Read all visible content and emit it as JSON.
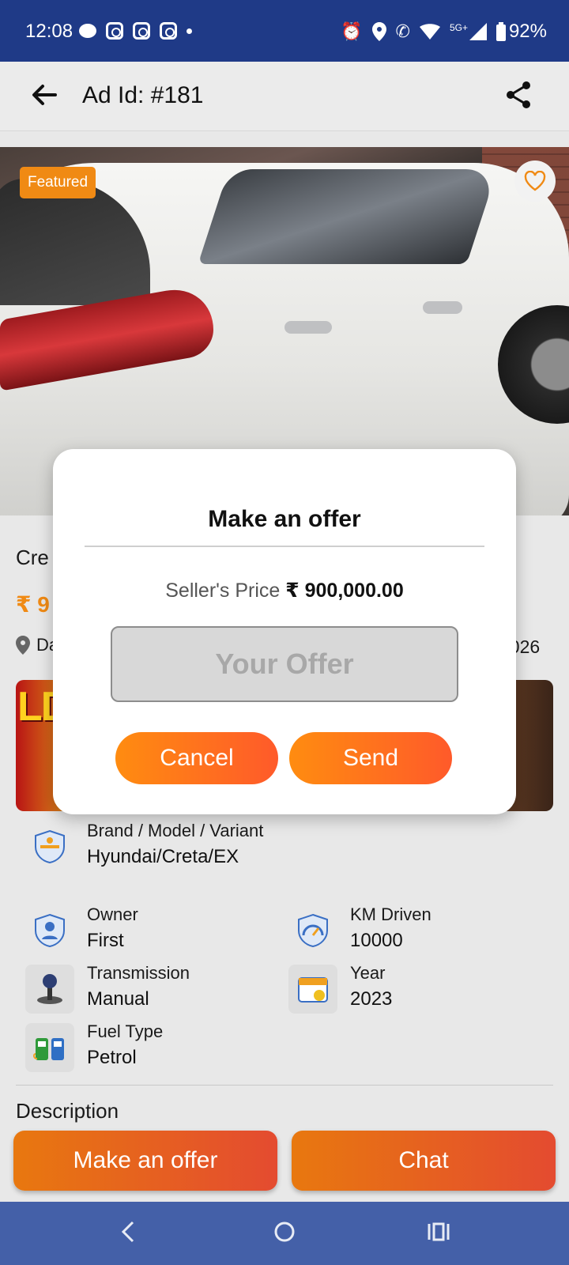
{
  "status_bar": {
    "time": "12:08",
    "network": "5G+",
    "battery": "92%",
    "left_icons": [
      "message-icon",
      "instagram-icon",
      "instagram-icon",
      "instagram-icon",
      "dot-icon"
    ],
    "right_icons": [
      "alarm-icon",
      "location-icon",
      "wifi-call-icon",
      "wifi-icon",
      "signal-icon",
      "battery-icon"
    ]
  },
  "app_bar": {
    "title": "Ad Id: #181",
    "back_icon": "arrow-left-icon",
    "share_icon": "share-icon"
  },
  "listing": {
    "featured_badge": "Featured",
    "favorite_icon": "heart-outline-icon",
    "title_partial": "Cre",
    "price_partial": "₹ 9",
    "location_partial": "Da",
    "date_partial": "2026",
    "banner_text_partial": "LD"
  },
  "specs": [
    {
      "label": "Brand / Model / Variant",
      "value": "Hyundai/Creta/EX",
      "icon": "brand-badge-icon"
    },
    {
      "label": "Owner",
      "value": "First",
      "icon": "owner-shield-icon"
    },
    {
      "label": "KM Driven",
      "value": "10000",
      "icon": "speedometer-icon"
    },
    {
      "label": "Transmission",
      "value": "Manual",
      "icon": "gear-stick-icon"
    },
    {
      "label": "Year",
      "value": "2023",
      "icon": "calendar-icon"
    },
    {
      "label": "Fuel Type",
      "value": "Petrol",
      "icon": "fuel-pump-icon"
    }
  ],
  "description_heading": "Description",
  "bottom_actions": {
    "make_offer": "Make an offer",
    "chat": "Chat"
  },
  "dialog": {
    "title": "Make an offer",
    "seller_label": "Seller's Price",
    "seller_price": "₹ 900,000.00",
    "offer_placeholder": "Your Offer",
    "offer_value": "",
    "cancel": "Cancel",
    "send": "Send"
  },
  "colors": {
    "status_bar": "#1f3a87",
    "accent_orange": "#f08a14",
    "button_gradient_end": "#e44b30",
    "nav_bar": "#4460a8"
  }
}
